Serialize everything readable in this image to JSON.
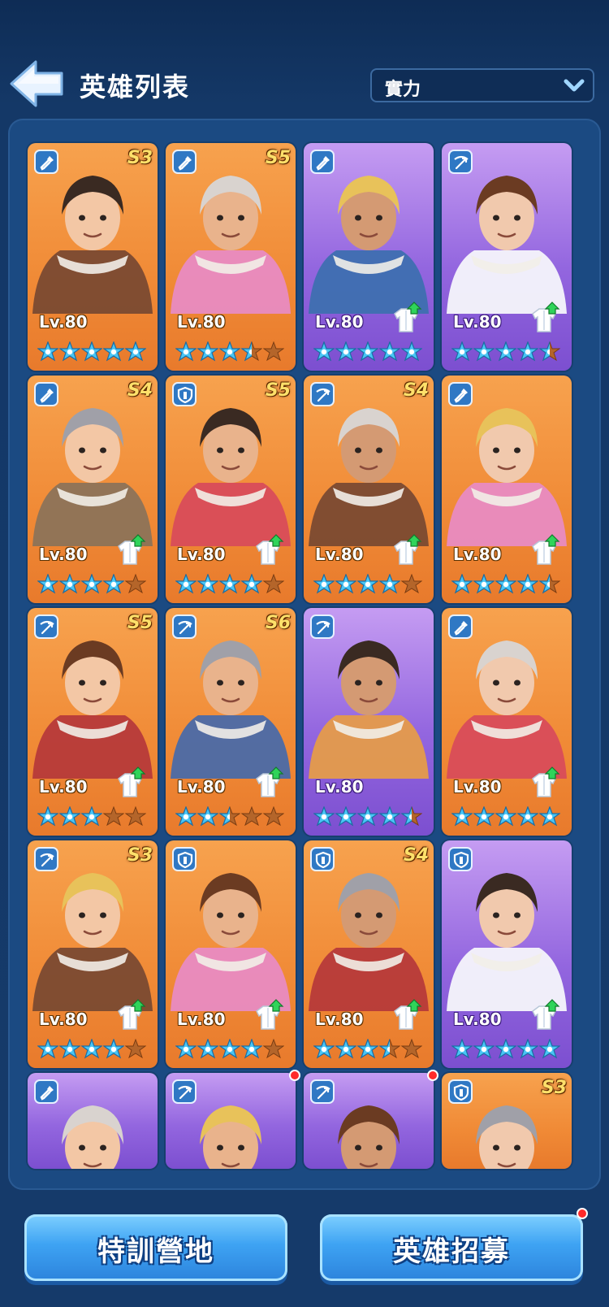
{
  "header": {
    "title": "英雄列表",
    "sort_select": {
      "value": "實力"
    }
  },
  "colors": {
    "orange_card": "#f08a36",
    "purple_card": "#9366df",
    "star": "#49c6f5",
    "star_empty": "#b4652a"
  },
  "heroes": [
    {
      "rarity": "orange",
      "role": "shovel",
      "tier": "S3",
      "level": "Lv.80",
      "stars": 5,
      "upgrade": false
    },
    {
      "rarity": "orange",
      "role": "shovel",
      "tier": "S5",
      "level": "Lv.80",
      "stars": 3.5,
      "upgrade": false
    },
    {
      "rarity": "purple",
      "role": "shovel",
      "tier": "",
      "level": "Lv.80",
      "stars": 5,
      "upgrade": true
    },
    {
      "rarity": "purple",
      "role": "crossbow",
      "tier": "",
      "level": "Lv.80",
      "stars": 4.5,
      "upgrade": true
    },
    {
      "rarity": "orange",
      "role": "shovel",
      "tier": "S4",
      "level": "Lv.80",
      "stars": 4,
      "upgrade": true
    },
    {
      "rarity": "orange",
      "role": "shield",
      "tier": "S5",
      "level": "Lv.80",
      "stars": 4,
      "upgrade": true
    },
    {
      "rarity": "orange",
      "role": "crossbow",
      "tier": "S4",
      "level": "Lv.80",
      "stars": 4,
      "upgrade": true
    },
    {
      "rarity": "orange",
      "role": "shovel",
      "tier": "",
      "level": "Lv.80",
      "stars": 4.5,
      "upgrade": true
    },
    {
      "rarity": "orange",
      "role": "crossbow",
      "tier": "S5",
      "level": "Lv.80",
      "stars": 3,
      "upgrade": true
    },
    {
      "rarity": "orange",
      "role": "crossbow",
      "tier": "S6",
      "level": "Lv.80",
      "stars": 2.5,
      "upgrade": true
    },
    {
      "rarity": "purple",
      "role": "crossbow",
      "tier": "",
      "level": "Lv.80",
      "stars": 4.5,
      "upgrade": false
    },
    {
      "rarity": "orange",
      "role": "shovel",
      "tier": "",
      "level": "Lv.80",
      "stars": 5,
      "upgrade": true
    },
    {
      "rarity": "orange",
      "role": "crossbow",
      "tier": "S3",
      "level": "Lv.80",
      "stars": 4,
      "upgrade": true
    },
    {
      "rarity": "orange",
      "role": "shield",
      "tier": "",
      "level": "Lv.80",
      "stars": 4,
      "upgrade": true
    },
    {
      "rarity": "orange",
      "role": "shield",
      "tier": "S4",
      "level": "Lv.80",
      "stars": 3.5,
      "upgrade": true
    },
    {
      "rarity": "purple",
      "role": "shield",
      "tier": "",
      "level": "Lv.80",
      "stars": 5,
      "upgrade": true
    },
    {
      "rarity": "purple",
      "role": "shovel",
      "tier": "",
      "level": "",
      "stars": 0,
      "upgrade": false,
      "partial": true
    },
    {
      "rarity": "purple",
      "role": "crossbow",
      "tier": "",
      "level": "",
      "stars": 0,
      "upgrade": false,
      "partial": true,
      "notify": true
    },
    {
      "rarity": "purple",
      "role": "crossbow",
      "tier": "",
      "level": "",
      "stars": 0,
      "upgrade": false,
      "partial": true,
      "notify": true
    },
    {
      "rarity": "orange",
      "role": "shield",
      "tier": "S3",
      "level": "",
      "stars": 0,
      "upgrade": false,
      "partial": true
    }
  ],
  "footer": {
    "training_button": "特訓營地",
    "recruit_button": "英雄招募",
    "recruit_notify": true
  }
}
